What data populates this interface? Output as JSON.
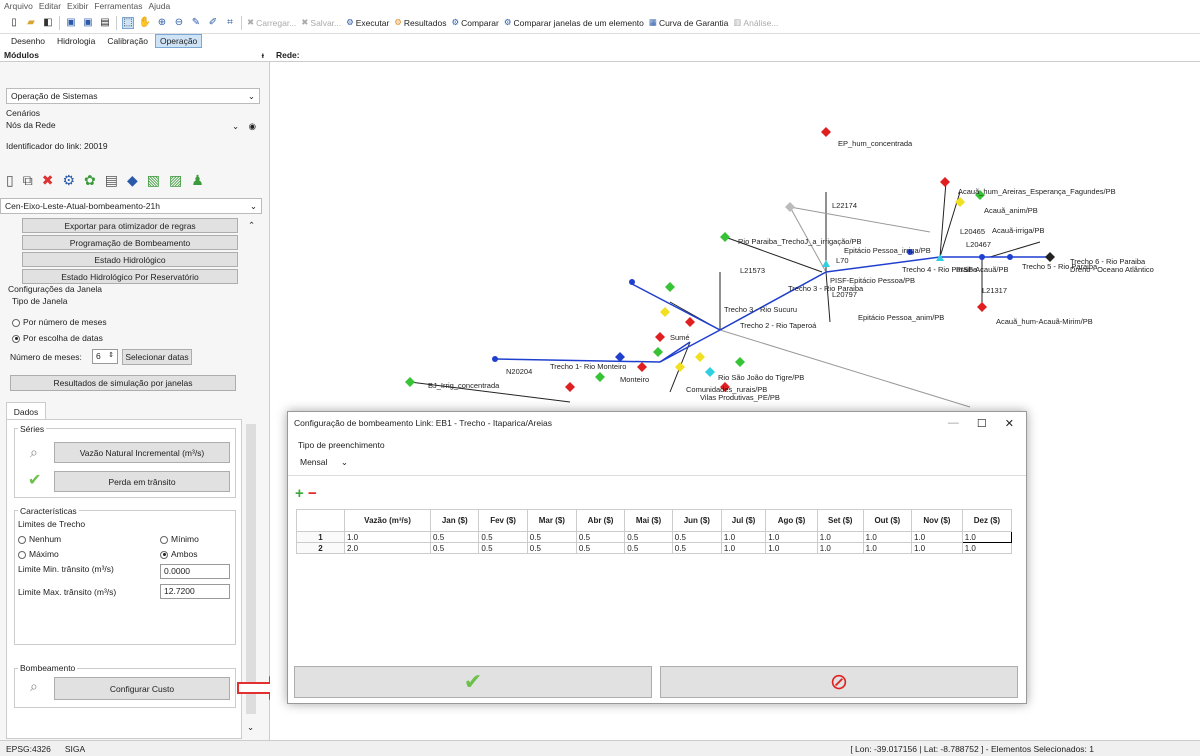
{
  "menu": [
    "Arquivo",
    "Editar",
    "Exibir",
    "Ferramentas",
    "Ajuda"
  ],
  "toolbar": {
    "carregar": "Carregar...",
    "salvar": "Salvar...",
    "executar": "Executar",
    "resultados": "Resultados",
    "comparar": "Comparar",
    "comparar_janelas": "Comparar janelas de um elemento",
    "curva": "Curva de Garantia",
    "analise": "Análise..."
  },
  "tabs": [
    "Desenho",
    "Hidrologia",
    "Calibração",
    "Operação"
  ],
  "panel_title": "Módulos",
  "panel_pin": "ᵼ",
  "map_title": "Rede:",
  "sidebar": {
    "module_combo": "Operação de Sistemas",
    "cenarios_label": "Cenários",
    "nos_label": "Nós da Rede",
    "identificador": "Identificador do link: 20019",
    "scenario_combo": "Cen-Eixo-Leste-Atual-bombeamento-21h",
    "menu_buttons": [
      "Exportar para otimizador de regras",
      "Programação de Bombeamento",
      "Estado Hidrológico",
      "Estado Hidrológico Por Reservatório"
    ],
    "config_janela": "Configurações da Janela",
    "tipo_janela": "Tipo de Janela",
    "por_numero": "Por número de meses",
    "por_escolha": "Por escolha de datas",
    "numero_meses_label": "Número de meses:",
    "numero_meses_value": "6",
    "selecionar_datas": "Selecionar datas",
    "resultados_janelas": "Resultados de simulação por janelas",
    "dados_tab": "Dados",
    "series_label": "Séries",
    "vazao_btn": "Vazão Natural Incremental (m³/s)",
    "perda_btn": "Perda em trânsito",
    "caracteristicas": "Características",
    "limites_trecho": "Limites de Trecho",
    "nenhum": "Nenhum",
    "minimo": "Mínimo",
    "maximo": "Máximo",
    "ambos": "Ambos",
    "lim_min_label": "Limite Min. trânsito (m³/s)",
    "lim_min_value": "0.0000",
    "lim_max_label": "Limite Max. trânsito (m³/s)",
    "lim_max_value": "12.7200",
    "bombeamento": "Bombeamento",
    "configurar_custo": "Configurar Custo"
  },
  "map": {
    "labels": [
      "EP_hum_concentrada",
      "L22174",
      "Acauã_hum_Areiras_Esperança_Fagundes/PB",
      "Acauã_anim/PB",
      "Acauã-irriga/PB",
      "L20465",
      "L20467",
      "Rio Paraiba_TrechoJ_a_irrigação/PB",
      "Epitácio Pessoa_irriga/PB",
      "L70",
      "Trecho 4 - Rio Paraiba",
      "PISF-Acauã/PB",
      "Trecho 5 - Rio Paraiba",
      "Trecho 6 - Rio Paraiba",
      "Dreno - Oceano Atlântico",
      "L21573",
      "PISF-Epitácio Pessoa/PB",
      "Trecho 3 - Rio Paraiba",
      "L20797",
      "L21317",
      "Epitácio Pessoa_anim/PB",
      "Acauã_hum-Acauã-Mirim/PB",
      "Trecho 3 - Rio Sucuru",
      "Trecho 2 - Rio Taperoá",
      "Sumé",
      "N20204",
      "Trecho 1- Rio Monteiro",
      "Monteiro",
      "BJ_Irrig_concentrada",
      "Rio São João do Tigre/PB",
      "Comunidades_rurais/PB",
      "Vilas Produtivas_PE/PB"
    ]
  },
  "dialog": {
    "title": "Configuração de bombeamento Link: EB1 - Trecho - Itaparica/Areias",
    "tipo_label": "Tipo de preenchimento",
    "tipo_value": "Mensal",
    "add_icon": "+",
    "remove_icon": "−",
    "columns": [
      "",
      "Vazão (m³/s)",
      "Jan ($)",
      "Fev ($)",
      "Mar ($)",
      "Abr ($)",
      "Mai ($)",
      "Jun ($)",
      "Jul ($)",
      "Ago ($)",
      "Set ($)",
      "Out ($)",
      "Nov ($)",
      "Dez ($)"
    ],
    "rows": [
      [
        "1",
        "1.0",
        "0.5",
        "0.5",
        "0.5",
        "0.5",
        "0.5",
        "0.5",
        "1.0",
        "1.0",
        "1.0",
        "1.0",
        "1.0",
        "1.0"
      ],
      [
        "2",
        "2.0",
        "0.5",
        "0.5",
        "0.5",
        "0.5",
        "0.5",
        "0.5",
        "1.0",
        "1.0",
        "1.0",
        "1.0",
        "1.0",
        "1.0"
      ]
    ],
    "ok_icon": "✔",
    "cancel_icon": "⊘",
    "minimize": "—",
    "maximize": "☐",
    "close": "✕"
  },
  "status": {
    "epsg": "EPSG:4326",
    "siga": "SIGA",
    "coords": "[ Lon: -39.017156 | Lat: -8.788752 ] - Elementos Selecionados: 1"
  },
  "colors": {
    "accent": "#1a73c8",
    "green_check": "#6cc04a",
    "cancel_red": "#e02020",
    "arrow_red": "#e03030"
  }
}
